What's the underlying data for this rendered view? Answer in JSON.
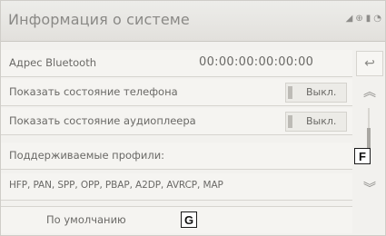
{
  "header": {
    "title": "Информация о системе",
    "status_icons": [
      "signal-icon",
      "lock-icon",
      "battery-icon",
      "wifi-icon"
    ]
  },
  "rows": {
    "bluetooth_address": {
      "label": "Адрес Bluetooth",
      "value": "00:00:00:00:00:00"
    },
    "show_phone_status": {
      "label": "Показать состояние телефона",
      "toggle_label": "Выкл."
    },
    "show_audio_status": {
      "label": "Показать состояние аудиоплеера",
      "toggle_label": "Выкл."
    },
    "supported_profiles": {
      "label": "Поддерживаемые профили:"
    },
    "profile_list": {
      "label": "HFP, PAN, SPP, OPP, PBAP, A2DP, AVRCP, MAP"
    }
  },
  "default_button": {
    "label": "По умолчанию"
  },
  "side": {
    "back_icon": "back-arrow-icon",
    "scroll_up_icon": "chevron-double-up-icon",
    "scroll_down_icon": "chevron-double-down-icon"
  },
  "callouts": {
    "f": "F",
    "g": "G"
  },
  "colors": {
    "background": "#f2f1ee",
    "text": "#6a6966",
    "header_text": "#8a8986",
    "divider": "#d6d4cf"
  }
}
